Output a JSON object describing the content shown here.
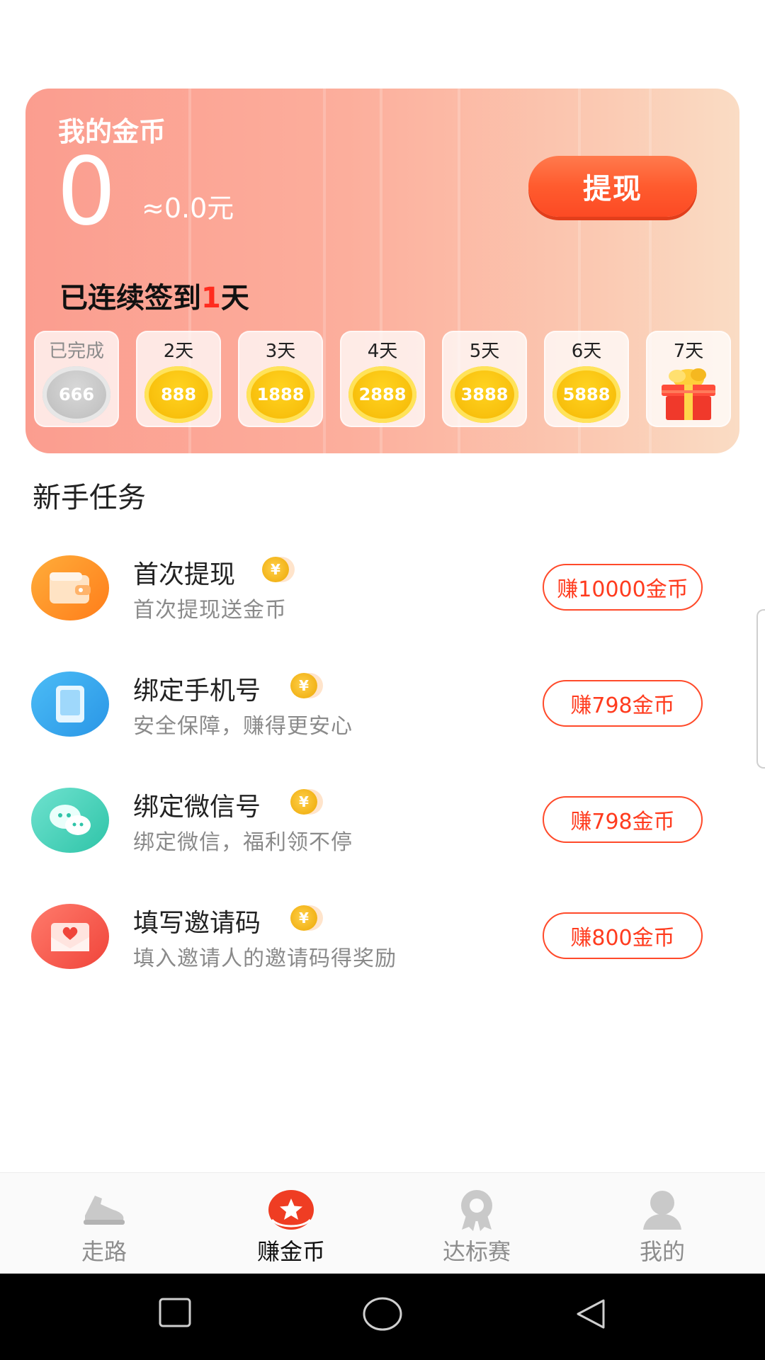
{
  "coin_card": {
    "title": "我的金币",
    "coins": "0",
    "rmb_estimate": "≈0.0元",
    "withdraw_label": "提现",
    "streak_prefix": "已连续签到",
    "streak_days": "1",
    "streak_suffix": "天",
    "days": [
      {
        "label": "已完成",
        "coins": "666",
        "state": "done"
      },
      {
        "label": "2天",
        "coins": "888",
        "state": "pending"
      },
      {
        "label": "3天",
        "coins": "1888",
        "state": "pending"
      },
      {
        "label": "4天",
        "coins": "2888",
        "state": "pending"
      },
      {
        "label": "5天",
        "coins": "3888",
        "state": "pending"
      },
      {
        "label": "6天",
        "coins": "5888",
        "state": "pending"
      },
      {
        "label": "7天",
        "coins": "",
        "state": "gift",
        "icon": "gift-box-icon"
      }
    ]
  },
  "tasks": {
    "section_title": "新手任务",
    "coin_glyph": "¥",
    "items": [
      {
        "title": "首次提现",
        "subtitle": "首次提现送金币",
        "reward": "赚10000金币",
        "icon": "wallet-icon",
        "color": "#ff8a1f"
      },
      {
        "title": "绑定手机号",
        "subtitle": "安全保障，赚得更安心",
        "reward": "赚798金币",
        "icon": "phone-icon",
        "color": "#35a9f2"
      },
      {
        "title": "绑定微信号",
        "subtitle": "绑定微信，福利领不停",
        "reward": "赚798金币",
        "icon": "wechat-icon",
        "color": "#3fd3b8"
      },
      {
        "title": "填写邀请码",
        "subtitle": "填入邀请人的邀请码得奖励",
        "reward": "赚800金币",
        "icon": "invite-envelope-icon",
        "color": "#ff5d4f"
      }
    ]
  },
  "tabbar": {
    "tabs": [
      {
        "label": "走路",
        "icon": "shoe-icon",
        "active": false
      },
      {
        "label": "赚金币",
        "icon": "coin-star-icon",
        "active": true
      },
      {
        "label": "达标赛",
        "icon": "medal-icon",
        "active": false
      },
      {
        "label": "我的",
        "icon": "user-icon",
        "active": false
      }
    ]
  },
  "colors": {
    "accent": "#ff4a2a",
    "card_gradient_start": "#fb9d8f",
    "card_gradient_end": "#fadcc4"
  }
}
